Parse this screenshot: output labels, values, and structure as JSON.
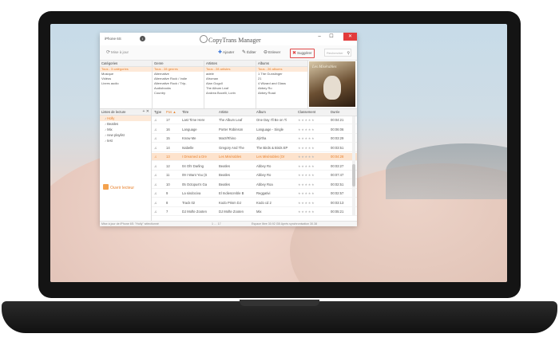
{
  "app": {
    "device": "iPhone 6S",
    "device_icon": "i",
    "title": "CopyTrans Manager",
    "window": {
      "minimize": "–",
      "maximize": "☐",
      "close": "✕"
    }
  },
  "toolbar": {
    "sync": "Mise à jour",
    "add": "Ajouter",
    "edit": "Éditer",
    "delete": "Enlever",
    "suggest": "Suggérer",
    "search_placeholder": "Rechercher",
    "feedback": "Feedback"
  },
  "categories": {
    "header": "Catégories",
    "items": [
      "Tous - 3 catégories",
      "Musique",
      "Vidéos",
      "Livres audio"
    ]
  },
  "genres": {
    "header": "Genre",
    "items": [
      "Tous - 28 genres",
      "Alternative",
      "Alternative Rock / Indie",
      "Alternative Rock / Trip-",
      "Audiobooks",
      "Country"
    ]
  },
  "artists": {
    "header": "Artistes",
    "items": [
      "Tous - 28 artistes",
      "adele",
      "Afroman",
      "Alan Gogoll",
      "The Album Leaf",
      "Andrea Bocelli, Lorin"
    ]
  },
  "albums": {
    "header": "Albums",
    "items": [
      "Tous - 26 albums",
      "1 The Gunslinger",
      "21",
      "4 Wizard and Glass",
      "Abbey Ro",
      "Abbey Road"
    ]
  },
  "album_art": {
    "text": "Les Misérables"
  },
  "playlists": {
    "header": "Listes de lecture",
    "buttons": "+ ✕",
    "items": [
      {
        "label": "Holly",
        "icon": "♪"
      },
      {
        "label": "Beatles",
        "icon": "♪"
      },
      {
        "label": "Mix",
        "icon": "♪"
      },
      {
        "label": "new playlist",
        "icon": "♪"
      },
      {
        "label": "test",
        "icon": "♪"
      }
    ],
    "open_library": "Ouvrir lecteur"
  },
  "table": {
    "headers": {
      "type": "Type",
      "pos": "Pos ▲",
      "title": "Titre",
      "artist": "Artiste",
      "album": "Album",
      "rating": "Classement",
      "duration": "Durée"
    },
    "rows": [
      {
        "type": "♫",
        "pos": "17",
        "title": "Last Time Here",
        "artist": "The Album Leaf",
        "album": "One Day I'll Be on Ti",
        "rating": "★★★★★",
        "duration": "00:04:21",
        "selected": false
      },
      {
        "type": "♫",
        "pos": "16",
        "title": "Language",
        "artist": "Porter Robinson",
        "album": "Language - Single",
        "rating": "★★★★★",
        "duration": "00:06:06",
        "selected": false
      },
      {
        "type": "♫",
        "pos": "15",
        "title": "Know Me",
        "artist": "Marz/Rhino",
        "album": "Jiýrtha",
        "rating": "★★★★★",
        "duration": "00:03:29",
        "selected": false
      },
      {
        "type": "♫",
        "pos": "14",
        "title": "Isabelle",
        "artist": "Gregory And The",
        "album": "The Birds & Birds EP",
        "rating": "★★★★★",
        "duration": "00:03:51",
        "selected": false
      },
      {
        "type": "♫",
        "pos": "13",
        "title": "I Dreamed a Dre",
        "artist": "Les Misérables",
        "album": "Les Misérables (Or",
        "rating": "★★★★★",
        "duration": "00:04:28",
        "selected": true
      },
      {
        "type": "♫",
        "pos": "12",
        "title": "04 Oh! Darling",
        "artist": "Beatles",
        "album": "Abbey Ro",
        "rating": "★★★★★",
        "duration": "00:03:27",
        "selected": false
      },
      {
        "type": "♫",
        "pos": "11",
        "title": "09 I Want You (S",
        "artist": "Beatles",
        "album": "Abbey Ro",
        "rating": "★★★★★",
        "duration": "00:07:47",
        "selected": false
      },
      {
        "type": "♫",
        "pos": "10",
        "title": "05 Octopus's Ga",
        "artist": "Beatles",
        "album": "Abbey Roa",
        "rating": "★★★★★",
        "duration": "00:02:51",
        "selected": false
      },
      {
        "type": "♫",
        "pos": "9",
        "title": "La sindociva",
        "artist": "El Indiescreble B",
        "album": "Reggativi",
        "rating": "★★★★★",
        "duration": "00:02:57",
        "selected": false
      },
      {
        "type": "♫",
        "pos": "8",
        "title": "Track 02",
        "artist": "Kodo Prism DJ",
        "album": "Kodo cd 2",
        "rating": "★★★★★",
        "duration": "00:03:13",
        "selected": false
      },
      {
        "type": "♫",
        "pos": "7",
        "title": "DJ Mofte Zooten",
        "artist": "DJ Mofte Zooten",
        "album": "Mix",
        "rating": "★★★★★",
        "duration": "00:05:21",
        "selected": false
      }
    ]
  },
  "status": {
    "left": "Mise à jour de iPhone 6S: \"Holly\" sélectionné",
    "middle": "1 … 17",
    "right": "Espace libre 30.92 GB Après synchronisation 30.38"
  }
}
